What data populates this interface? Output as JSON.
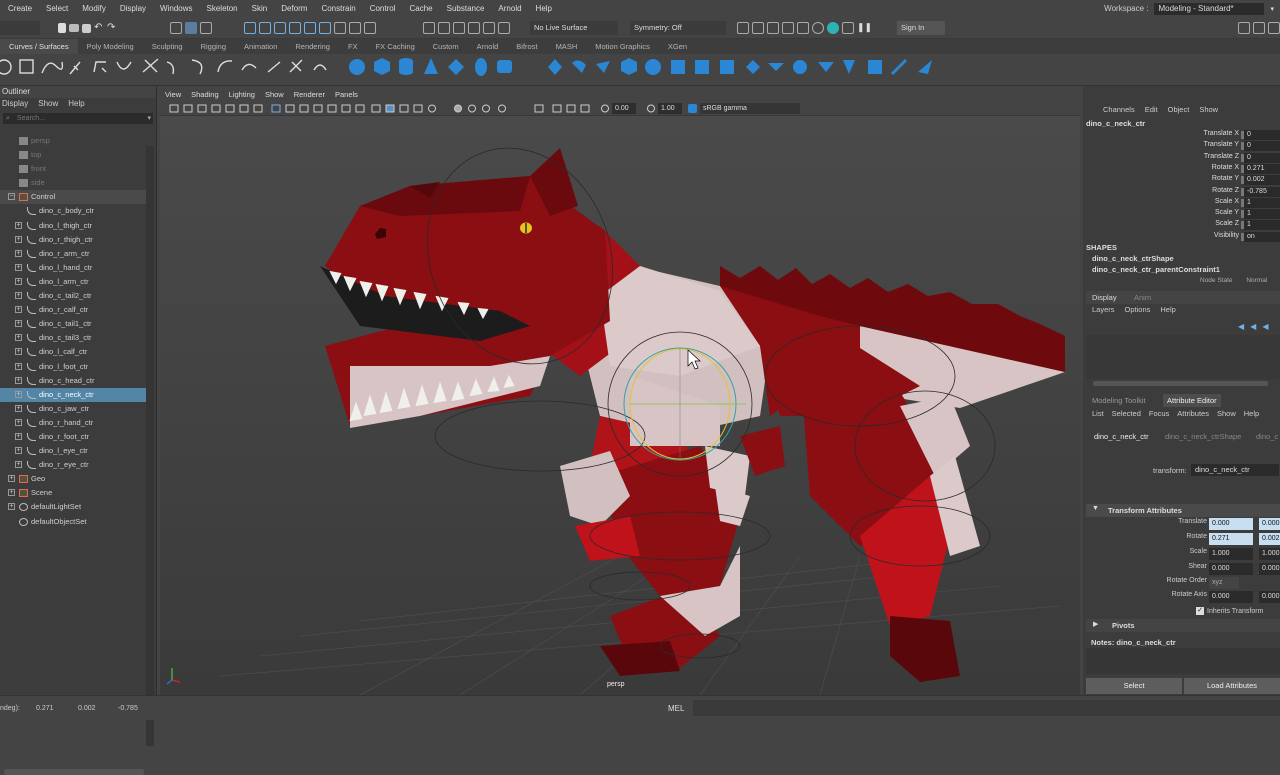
{
  "menubar": {
    "items": [
      "Create",
      "Select",
      "Modify",
      "Display",
      "Windows",
      "Skeleton",
      "Skin",
      "Deform",
      "Constrain",
      "Control",
      "Cache",
      "Substance",
      "Arnold",
      "Help"
    ],
    "workspace_label": "Workspace :",
    "workspace_value": "Modeling - Standard*"
  },
  "statusline": {
    "mode": "Curves / Surfaces",
    "live_surface": "No Live Surface",
    "symmetry": "Symmetry: Off",
    "sign_in": "Sign In"
  },
  "shelf_tabs": [
    "Curves / Surfaces",
    "Poly Modeling",
    "Sculpting",
    "Rigging",
    "Animation",
    "Rendering",
    "FX",
    "FX Caching",
    "Custom",
    "Arnold",
    "Bifrost",
    "MASH",
    "Motion Graphics",
    "XGen"
  ],
  "outliner": {
    "title": "Outliner",
    "menu": [
      "Display",
      "Show",
      "Help"
    ],
    "search_placeholder": "Search...",
    "items": [
      {
        "label": "persp",
        "depth": 1,
        "type": "camera",
        "dim": true
      },
      {
        "label": "top",
        "depth": 1,
        "type": "camera",
        "dim": true
      },
      {
        "label": "front",
        "depth": 1,
        "type": "camera",
        "dim": true
      },
      {
        "label": "side",
        "depth": 1,
        "type": "camera",
        "dim": true
      },
      {
        "label": "Control",
        "depth": 0,
        "type": "group",
        "expanded": true,
        "group": true
      },
      {
        "label": "dino_c_body_ctr",
        "depth": 1,
        "type": "curve"
      },
      {
        "label": "dino_l_thigh_ctr",
        "depth": 1,
        "type": "curve",
        "plus": true
      },
      {
        "label": "dino_r_thigh_ctr",
        "depth": 1,
        "type": "curve",
        "plus": true
      },
      {
        "label": "dino_r_arm_ctr",
        "depth": 1,
        "type": "curve",
        "plus": true
      },
      {
        "label": "dino_l_hand_ctr",
        "depth": 1,
        "type": "curve",
        "plus": true
      },
      {
        "label": "dino_l_arm_ctr",
        "depth": 1,
        "type": "curve",
        "plus": true
      },
      {
        "label": "dino_c_tail2_ctr",
        "depth": 1,
        "type": "curve",
        "plus": true
      },
      {
        "label": "dino_r_calf_ctr",
        "depth": 1,
        "type": "curve",
        "plus": true
      },
      {
        "label": "dino_c_tail1_ctr",
        "depth": 1,
        "type": "curve",
        "plus": true
      },
      {
        "label": "dino_c_tail3_ctr",
        "depth": 1,
        "type": "curve",
        "plus": true
      },
      {
        "label": "dino_l_calf_ctr",
        "depth": 1,
        "type": "curve",
        "plus": true
      },
      {
        "label": "dino_l_foot_ctr",
        "depth": 1,
        "type": "curve",
        "plus": true
      },
      {
        "label": "dino_c_head_ctr",
        "depth": 1,
        "type": "curve",
        "plus": true
      },
      {
        "label": "dino_c_neck_ctr",
        "depth": 1,
        "type": "curve",
        "plus": true,
        "selected": true
      },
      {
        "label": "dino_c_jaw_ctr",
        "depth": 1,
        "type": "curve",
        "plus": true
      },
      {
        "label": "dino_r_hand_ctr",
        "depth": 1,
        "type": "curve",
        "plus": true
      },
      {
        "label": "dino_r_foot_ctr",
        "depth": 1,
        "type": "curve",
        "plus": true
      },
      {
        "label": "dino_l_eye_ctr",
        "depth": 1,
        "type": "curve",
        "plus": true
      },
      {
        "label": "dino_r_eye_ctr",
        "depth": 1,
        "type": "curve",
        "plus": true
      },
      {
        "label": "Geo",
        "depth": 0,
        "type": "group",
        "plus": true
      },
      {
        "label": "Scene",
        "depth": 0,
        "type": "group",
        "plus": true
      },
      {
        "label": "defaultLightSet",
        "depth": 0,
        "type": "set",
        "plus": true
      },
      {
        "label": "defaultObjectSet",
        "depth": 0,
        "type": "set"
      }
    ]
  },
  "viewport": {
    "menu": [
      "View",
      "Shading",
      "Lighting",
      "Show",
      "Renderer",
      "Panels"
    ],
    "toolbar_value1": "0.00",
    "toolbar_value2": "1.00",
    "color_space": "sRGB gamma",
    "camera_label": "persp"
  },
  "channel_box": {
    "menu": [
      "Channels",
      "Edit",
      "Object",
      "Show"
    ],
    "object_name": "dino_c_neck_ctr",
    "channels": [
      {
        "name": "Translate X",
        "value": "0"
      },
      {
        "name": "Translate Y",
        "value": "0"
      },
      {
        "name": "Translate Z",
        "value": "0"
      },
      {
        "name": "Rotate X",
        "value": "0.271"
      },
      {
        "name": "Rotate Y",
        "value": "0.002"
      },
      {
        "name": "Rotate Z",
        "value": "-0.785"
      },
      {
        "name": "Scale X",
        "value": "1"
      },
      {
        "name": "Scale Y",
        "value": "1"
      },
      {
        "name": "Scale Z",
        "value": "1"
      },
      {
        "name": "Visibility",
        "value": "on"
      }
    ],
    "shapes_header": "SHAPES",
    "shapes": [
      "dino_c_neck_ctrShape",
      "dino_c_neck_ctr_parentConstraint1"
    ],
    "node_state_label": "Node State",
    "node_state_value": "Normal"
  },
  "layer_editor": {
    "tabs": [
      "Display",
      "Anim"
    ],
    "menu": [
      "Layers",
      "Options",
      "Help"
    ]
  },
  "attribute_editor": {
    "tabs": [
      "Modeling Toolkit",
      "Attribute Editor"
    ],
    "menu": [
      "List",
      "Selected",
      "Focus",
      "Attributes",
      "Show",
      "Help"
    ],
    "node_tabs": [
      "dino_c_neck_ctr",
      "dino_c_neck_ctrShape",
      "dino_c"
    ],
    "transform_label": "transform:",
    "transform_value": "dino_c_neck_ctr",
    "section_transform": "Transform Attributes",
    "rows": [
      {
        "label": "Translate",
        "values": [
          "0.000",
          "0.000"
        ]
      },
      {
        "label": "Rotate",
        "values": [
          "0.271",
          "0.002"
        ]
      },
      {
        "label": "Scale",
        "values": [
          "1.000",
          "1.000"
        ]
      },
      {
        "label": "Shear",
        "values": [
          "0.000",
          "0.000"
        ]
      },
      {
        "label": "Rotate Order",
        "values": [
          "xyz"
        ]
      },
      {
        "label": "Rotate Axis",
        "values": [
          "0.000",
          "0.000"
        ]
      }
    ],
    "inherits_label": "Inherits Transform",
    "section_pivots": "Pivots",
    "notes": "Notes:  dino_c_neck_ctr",
    "select_button": "Select",
    "load_button": "Load Attributes"
  },
  "bottom": {
    "prefix": "ndeg):",
    "v1": "0.271",
    "v2": "0.002",
    "v3": "-0.785",
    "mel": "MEL"
  },
  "colors": {
    "selection": "#5285a6",
    "dino_red": "#8a0e12",
    "dino_light": "#d8c4c4",
    "accent_blue": "#3a8fd9"
  }
}
